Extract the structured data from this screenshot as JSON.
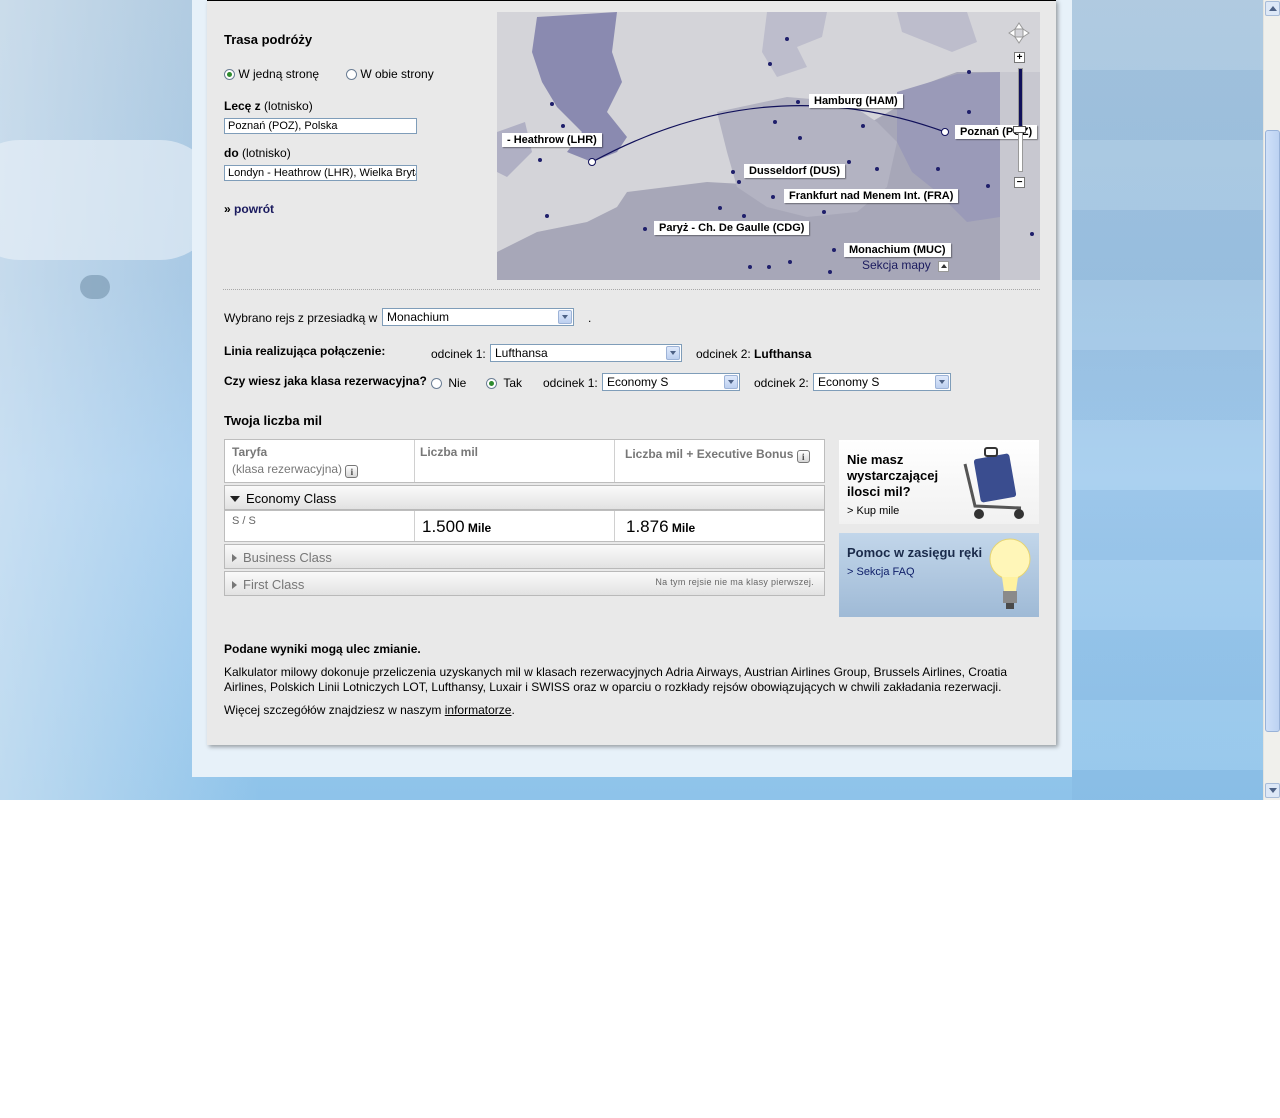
{
  "route": {
    "title": "Trasa podróży",
    "one_way_label": "W jedną stronę",
    "round_trip_label": "W obie strony",
    "from_label_bold": "Lecę z",
    "from_label_rest": "(lotnisko)",
    "from_value": "Poznań (POZ), Polska",
    "to_label_bold": "do",
    "to_label_rest": "(lotnisko)",
    "to_value": "Londyn - Heathrow (LHR), Wielka Bryta",
    "back_link": "powrót",
    "back_marker": "»"
  },
  "map": {
    "airports": [
      {
        "id": "lhr",
        "label": "- Heathrow (LHR)"
      },
      {
        "id": "ham",
        "label": "Hamburg (HAM)"
      },
      {
        "id": "poz",
        "label": "Poznań (POZ)"
      },
      {
        "id": "dus",
        "label": "Dusseldorf (DUS)"
      },
      {
        "id": "fra",
        "label": "Frankfurt nad Menem Int. (FRA)"
      },
      {
        "id": "cdg",
        "label": "Paryż - Ch. De Gaulle (CDG)"
      },
      {
        "id": "muc",
        "label": "Monachium (MUC)"
      }
    ],
    "section_link": "Sekcja mapy",
    "zoom_in": "+",
    "zoom_out": "−",
    "zoom_level": 0.4
  },
  "connection": {
    "transfer_label": "Wybrano rejs z przesiadką w",
    "transfer_value": "Monachium",
    "transfer_trailing": ".",
    "airline_label": "Linia realizująca połączenie:",
    "seg1_label": "odcinek 1:",
    "seg1_airline": "Lufthansa",
    "seg2_label": "odcinek 2:",
    "seg2_airline": "Lufthansa",
    "class_question": "Czy wiesz jaka klasa rezerwacyjna?",
    "no_label": "Nie",
    "yes_label": "Tak",
    "seg1_class": "Economy S",
    "seg2_class": "Economy S"
  },
  "miles": {
    "title": "Twoja liczba mil",
    "col_fare": "Taryfa",
    "col_fare_sub": "(klasa rezerwacyjna)",
    "col_miles": "Liczba mil",
    "col_bonus": "Liczba mil + Executive Bonus",
    "info_glyph": "i",
    "economy_title": "Economy Class",
    "economy_fare": "S / S",
    "economy_miles": "1.500",
    "economy_bonus": "1.876",
    "miles_unit": "Mile",
    "business_title": "Business Class",
    "first_title": "First Class",
    "first_note": "Na tym rejsie nie ma klasy pierwszej."
  },
  "promo": {
    "buy_title_1": "Nie masz",
    "buy_title_2": "wystarczającej",
    "buy_title_3": "ilosci mil?",
    "buy_link": "> Kup mile",
    "help_title": "Pomoc w zasięgu ręki",
    "help_link": "> Sekcja FAQ"
  },
  "notes": {
    "title": "Podane wyniki mogą ulec zmianie.",
    "body": "Kalkulator milowy dokonuje przeliczenia uzyskanych mil w klasach rezerwacyjnych Adria Airways, Austrian Airlines Group, Brussels Airlines, Croatia Airlines, Polskich Linii Lotniczych LOT, Lufthansy, Luxair i SWISS oraz w oparciu o rozkłady rejsów obowiązujących w chwili zakładania rezerwacji.",
    "more_prefix": "Więcej szczegółów znajdziesz w naszym",
    "more_link": "informatorze",
    "more_suffix": "."
  }
}
